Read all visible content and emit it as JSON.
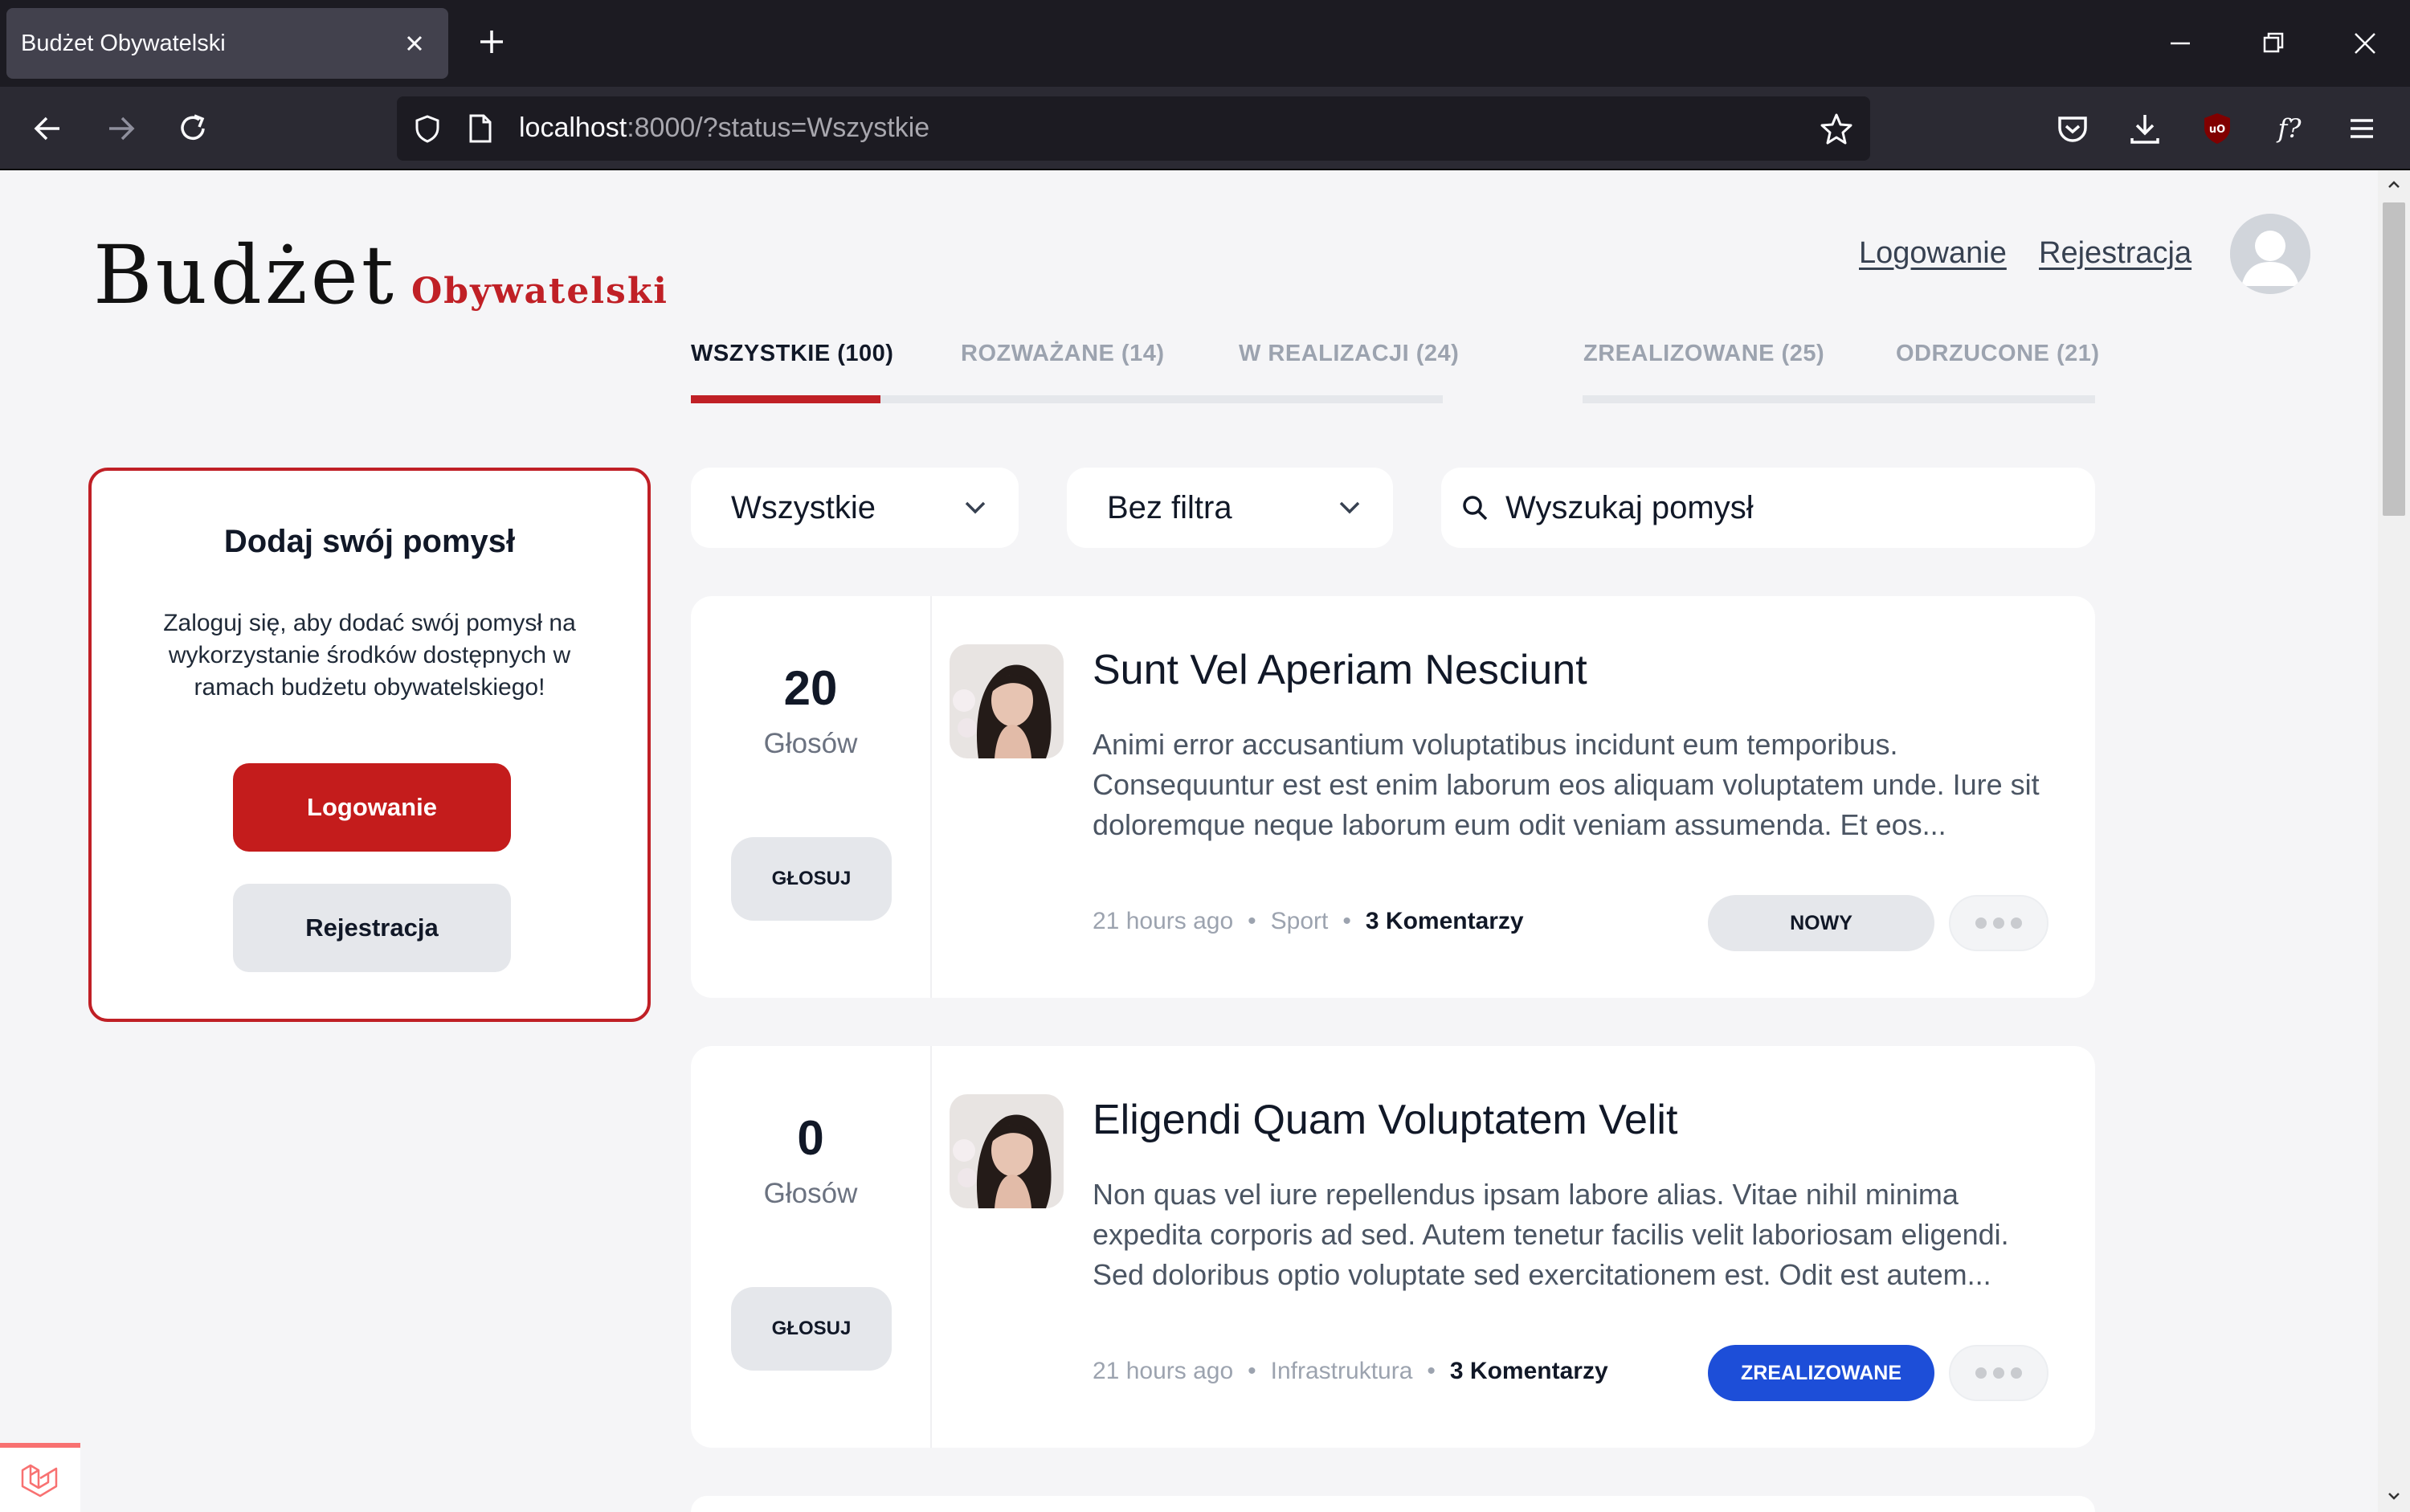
{
  "browser": {
    "tab_title": "Budżet Obywatelski",
    "url_host": "localhost",
    "url_rest": ":8000/?status=Wszystkie"
  },
  "site": {
    "logo_main": "Budżet",
    "logo_sub": "Obywatelski",
    "login_link": "Logowanie",
    "register_link": "Rejestracja"
  },
  "tabs": [
    {
      "label": "WSZYSTKIE (100)",
      "active": true
    },
    {
      "label": "ROZWAŻANE (14)",
      "active": false
    },
    {
      "label": "W REALIZACJI (24)",
      "active": false
    },
    {
      "label": "ZREALIZOWANE (25)",
      "active": false
    },
    {
      "label": "ODRZUCONE (21)",
      "active": false
    }
  ],
  "cta": {
    "title": "Dodaj swój pomysł",
    "text": "Zaloguj się, aby dodać swój pomysł na wykorzystanie środków dostępnych w ramach budżetu obywatelskiego!",
    "login_button": "Logowanie",
    "register_button": "Rejestracja"
  },
  "filters": {
    "category": "Wszystkie",
    "filter": "Bez filtra",
    "search_placeholder": "Wyszukaj pomysł"
  },
  "ideas": [
    {
      "votes": "20",
      "votes_label": "Głosów",
      "vote_button": "GŁOSUJ",
      "title": "Sunt Vel Aperiam Nesciunt",
      "description": "Animi error accusantium voluptatibus incidunt eum temporibus. Consequuntur est est enim laborum eos aliquam voluptatem unde. Iure sit doloremque neque laborum eum odit veniam assumenda. Et eos...",
      "time": "21 hours ago",
      "category": "Sport",
      "comments": "3 Komentarzy",
      "status": "NOWY",
      "status_color": "#e5e7eb"
    },
    {
      "votes": "0",
      "votes_label": "Głosów",
      "vote_button": "GŁOSUJ",
      "title": "Eligendi Quam Voluptatem Velit",
      "description": "Non quas vel iure repellendus ipsam labore alias. Vitae nihil minima expedita corporis ad sed. Autem tenetur facilis velit laboriosam eligendi. Sed doloribus optio voluptate sed exercitationem est. Odit est autem...",
      "time": "21 hours ago",
      "category": "Infrastruktura",
      "comments": "3 Komentarzy",
      "status": "ZREALIZOWANE",
      "status_color": "#1d4ed8"
    }
  ],
  "colors": {
    "brand_red": "#c02026",
    "status_done_blue": "#1d4ed8"
  }
}
